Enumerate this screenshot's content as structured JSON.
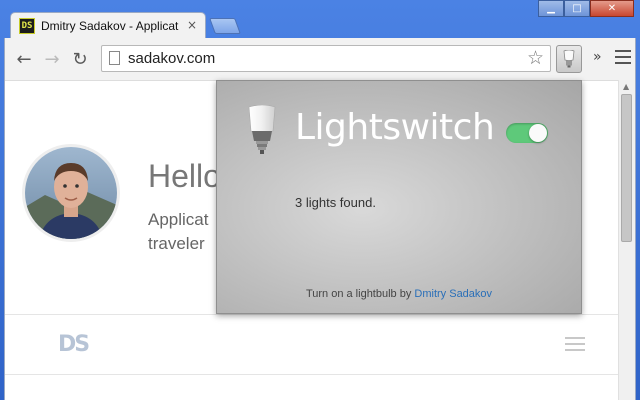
{
  "window": {
    "controls": {
      "minimize": "▁",
      "maximize": "□",
      "close": "✕"
    }
  },
  "tab": {
    "favicon_text": "DS",
    "title": "Dmitry Sadakov - Applicat",
    "close": "×"
  },
  "toolbar": {
    "back": "←",
    "forward": "→",
    "reload": "↻",
    "url": "sadakov.com",
    "star": "☆",
    "overflow": "»"
  },
  "page": {
    "heading": "Hello",
    "subtitle_line1": "Applicat",
    "subtitle_line2": "traveler",
    "logo": "DS"
  },
  "popup": {
    "title": "Lightswitch",
    "toggle_on": true,
    "status": "3 lights found.",
    "footer_text": "Turn on a lightbulb by",
    "footer_link": "Dmitry Sadakov",
    "colors": {
      "toggle": "#5ec97a",
      "link": "#2a6fb8"
    }
  }
}
